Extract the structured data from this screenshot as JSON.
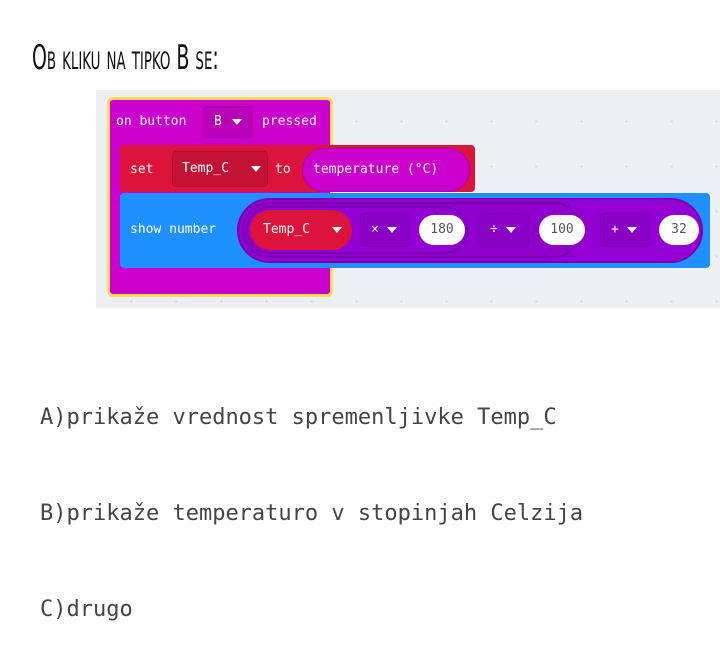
{
  "title": "Ob kliku na tipko B se:",
  "blocks": {
    "event": {
      "prefix": "on button",
      "button": "B",
      "suffix": "pressed"
    },
    "set": {
      "keyword": "set",
      "variable": "Temp_C",
      "to": "to",
      "value": "temperature (°C)"
    },
    "show": {
      "keyword": "show number",
      "variable": "Temp_C",
      "op1": "×",
      "num1": "180",
      "op2": "÷",
      "num2": "100",
      "op3": "+",
      "num3": "32"
    }
  },
  "colors": {
    "event": "#cc00cc",
    "variables": "#dc143c",
    "basic": "#1e90ff",
    "math": "#9400d3",
    "highlight": "#ffd95a"
  },
  "answers": [
    {
      "letter": "A)",
      "text": "prikaže vrednost spremenljivke Temp_C"
    },
    {
      "letter": "B)",
      "text": "prikaže temperaturo v stopinjah Celzija"
    },
    {
      "letter": "C)",
      "text": "drugo"
    }
  ]
}
